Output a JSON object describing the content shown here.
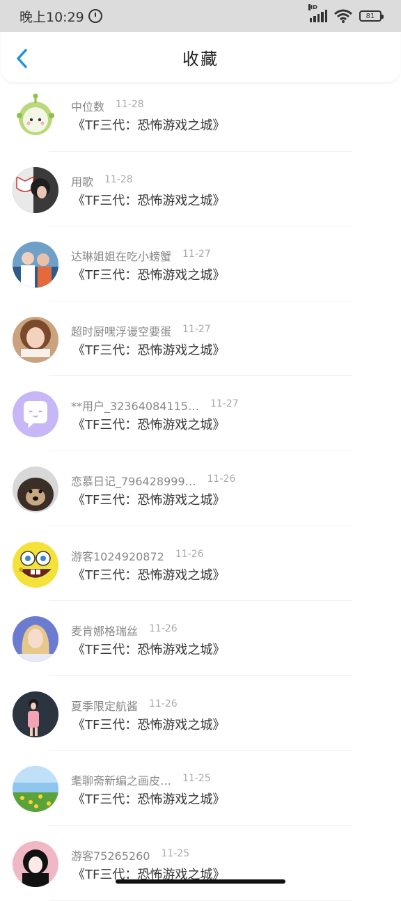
{
  "status": {
    "time": "晚上10:29",
    "battery": "81",
    "network": "HD"
  },
  "nav": {
    "title": "收藏",
    "back_icon": "chevron-left-icon"
  },
  "items": [
    {
      "user": "中位数",
      "date": "11-28",
      "title": "《TF三代：恐怖游戏之城》",
      "avatar": "alien"
    },
    {
      "user": "用歌",
      "date": "11-28",
      "title": "《TF三代：恐怖游戏之城》",
      "avatar": "mask"
    },
    {
      "user": "达琳姐姐在吃小螃蟹",
      "date": "11-27",
      "title": "《TF三代：恐怖游戏之城》",
      "avatar": "people"
    },
    {
      "user": "超时厨嘿浮谩空要蛋",
      "date": "11-27",
      "title": "《TF三代：恐怖游戏之城》",
      "avatar": "girl"
    },
    {
      "user": "**用户_32364084115…",
      "date": "11-27",
      "title": "《TF三代：恐怖游戏之城》",
      "avatar": "purple"
    },
    {
      "user": "恋慕日记_796428999…",
      "date": "11-26",
      "title": "《TF三代：恐怖游戏之城》",
      "avatar": "dog"
    },
    {
      "user": "游客1024920872",
      "date": "11-26",
      "title": "《TF三代：恐怖游戏之城》",
      "avatar": "sponge"
    },
    {
      "user": "麦肯娜格瑞丝",
      "date": "11-26",
      "title": "《TF三代：恐怖游戏之城》",
      "avatar": "blonde"
    },
    {
      "user": "夏季限定航酱",
      "date": "11-26",
      "title": "《TF三代：恐怖游戏之城》",
      "avatar": "pink"
    },
    {
      "user": "耄聊斋新编之画皮…",
      "date": "11-25",
      "title": "《TF三代：恐怖游戏之城》",
      "avatar": "flowers"
    },
    {
      "user": "游客75265260",
      "date": "11-25",
      "title": "《TF三代：恐怖游戏之城》",
      "avatar": "mono"
    }
  ],
  "colors": {
    "accent": "#1e90e6",
    "status_bg": "#dcdcdc"
  }
}
